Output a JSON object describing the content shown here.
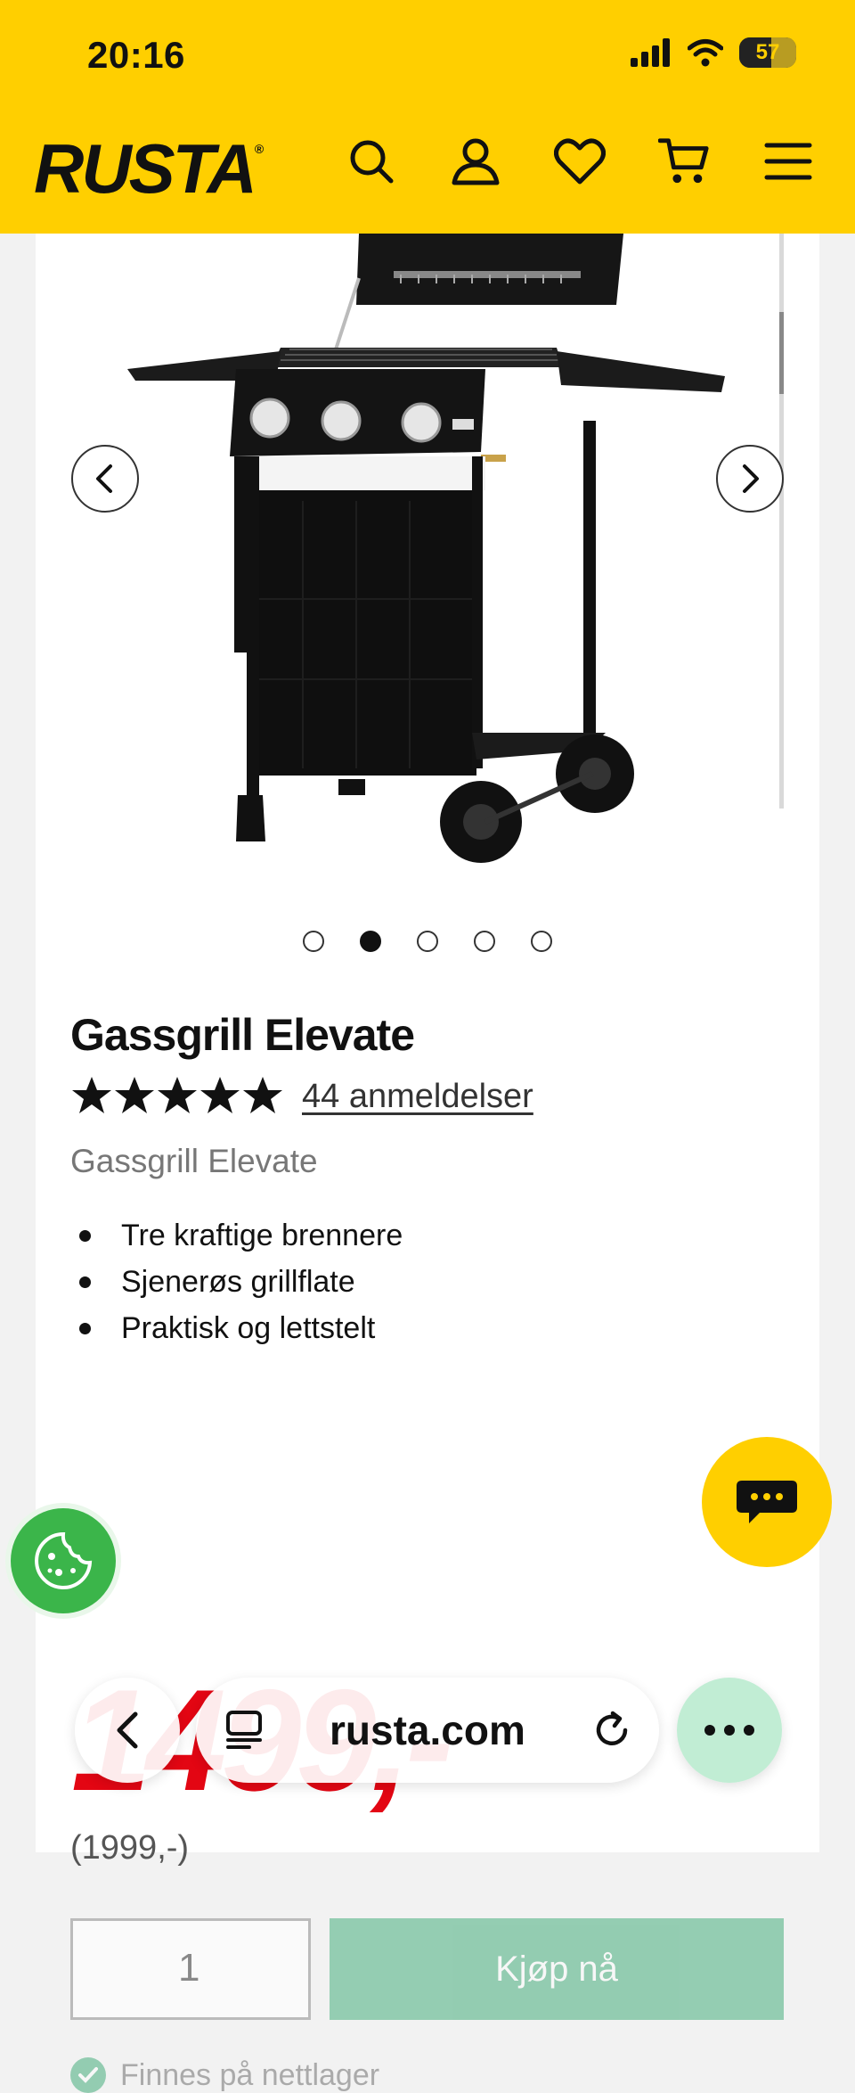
{
  "status_bar": {
    "time": "20:16",
    "battery": "57",
    "battery_level": 0.57
  },
  "header": {
    "logo": "RUSTA",
    "icons": [
      "search-icon",
      "account-icon",
      "wishlist-heart-icon",
      "cart-icon",
      "menu-icon"
    ]
  },
  "gallery": {
    "slide_count": 5,
    "active_slide": 2,
    "image_alt": "Black three-burner gas grill with side tables and wheels"
  },
  "product": {
    "title": "Gassgrill Elevate",
    "rating": 4.5,
    "reviews_label": "44 anmeldelser",
    "subtitle": "Gassgrill Elevate",
    "features": [
      "Tre kraftige brennere",
      "Sjenerøs grillflate",
      "Praktisk og lettstelt"
    ],
    "price": "1499,-",
    "old_price": "(1999,-)",
    "quantity": "1",
    "add_to_cart_label": "Kjøp nå",
    "stock_status": "Finnes på nettlager"
  },
  "browser": {
    "url": "rusta.com"
  },
  "colors": {
    "brand_yellow": "#FFCF00",
    "price_red": "#E30613",
    "success_green": "#22a063"
  }
}
